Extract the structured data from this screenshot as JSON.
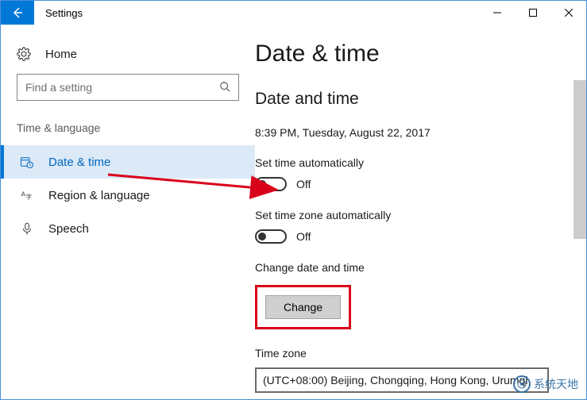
{
  "window": {
    "title": "Settings"
  },
  "sidebar": {
    "home_label": "Home",
    "search_placeholder": "Find a setting",
    "category": "Time & language",
    "items": [
      {
        "label": "Date & time"
      },
      {
        "label": "Region & language"
      },
      {
        "label": "Speech"
      }
    ]
  },
  "content": {
    "page_title": "Date & time",
    "section_title": "Date and time",
    "current_time": "8:39 PM, Tuesday, August 22, 2017",
    "auto_time": {
      "label": "Set time automatically",
      "state": "Off"
    },
    "auto_tz": {
      "label": "Set time zone automatically",
      "state": "Off"
    },
    "change": {
      "label": "Change date and time",
      "button": "Change"
    },
    "timezone": {
      "label": "Time zone",
      "value": "(UTC+08:00) Beijing, Chongqing, Hong Kong, Urumqi"
    }
  },
  "watermark": "系统天地"
}
